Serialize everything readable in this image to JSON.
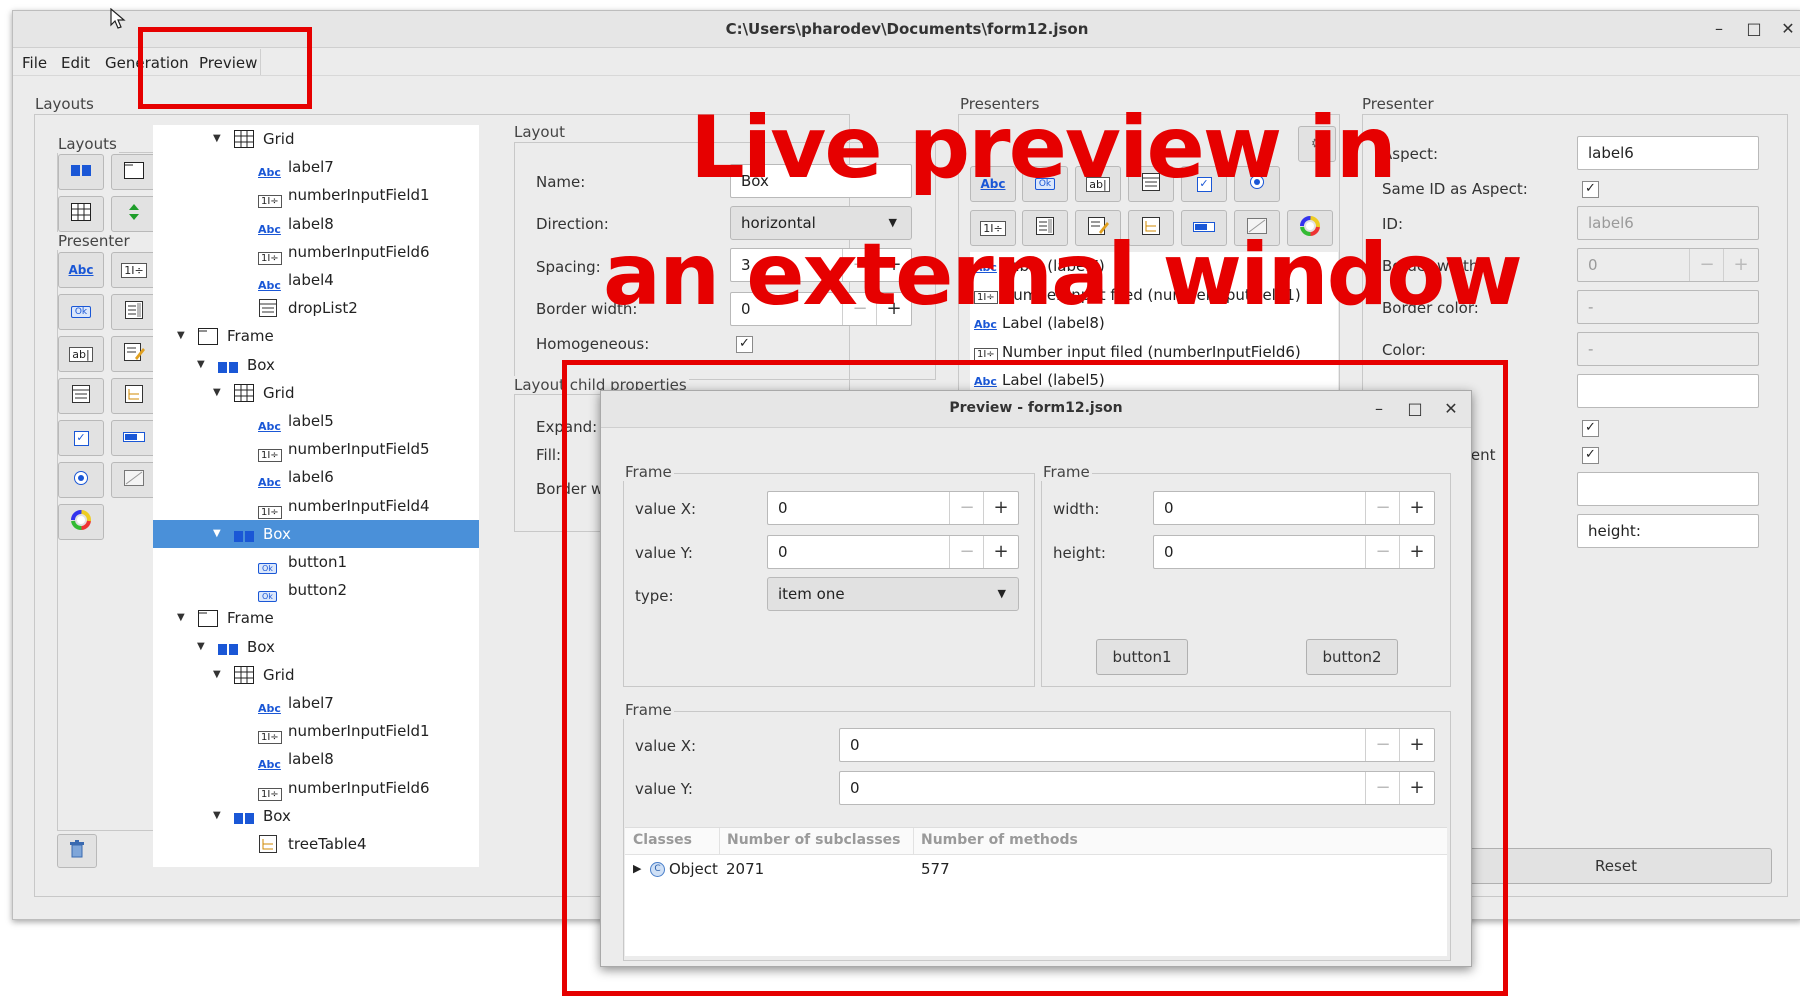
{
  "window": {
    "title": "C:\\Users\\pharodev\\Documents\\form12.json",
    "minimize": "–",
    "maximize": "□",
    "close": "✕"
  },
  "menu": [
    "File",
    "Edit",
    "Generation",
    "Preview"
  ],
  "layouts_panel": {
    "title": "Layouts",
    "layouts_label": "Layouts",
    "presenter_label": "Presenter",
    "tree": [
      {
        "label": "Grid",
        "icon": "grid"
      },
      {
        "label": "label7",
        "icon": "label"
      },
      {
        "label": "numberInputField1",
        "icon": "number"
      },
      {
        "label": "label8",
        "icon": "label"
      },
      {
        "label": "numberInputField6",
        "icon": "number"
      },
      {
        "label": "label4",
        "icon": "label"
      },
      {
        "label": "dropList2",
        "icon": "droplist"
      },
      {
        "label": "Frame",
        "icon": "frame"
      },
      {
        "label": "Box",
        "icon": "box"
      },
      {
        "label": "Grid",
        "icon": "grid"
      },
      {
        "label": "label5",
        "icon": "label"
      },
      {
        "label": "numberInputField5",
        "icon": "number"
      },
      {
        "label": "label6",
        "icon": "label"
      },
      {
        "label": "numberInputField4",
        "icon": "number"
      },
      {
        "label": "Box",
        "icon": "box"
      },
      {
        "label": "button1",
        "icon": "button"
      },
      {
        "label": "button2",
        "icon": "button"
      },
      {
        "label": "Frame",
        "icon": "frame"
      },
      {
        "label": "Box",
        "icon": "box"
      },
      {
        "label": "Grid",
        "icon": "grid"
      },
      {
        "label": "label7",
        "icon": "label"
      },
      {
        "label": "numberInputField1",
        "icon": "number"
      },
      {
        "label": "label8",
        "icon": "label"
      },
      {
        "label": "numberInputField6",
        "icon": "number"
      },
      {
        "label": "Box",
        "icon": "box"
      },
      {
        "label": "treeTable4",
        "icon": "tree"
      }
    ]
  },
  "layout_panel": {
    "title": "Layout",
    "name_label": "Name:",
    "name_value": "Box",
    "direction_label": "Direction:",
    "direction_value": "horizontal",
    "spacing_label": "Spacing:",
    "spacing_value": "3",
    "border_width_label": "Border width:",
    "border_width_value": "0",
    "homogeneous_label": "Homogeneous:",
    "child_props_title": "Layout child properties",
    "expand_label": "Expand:",
    "fill_label": "Fill:",
    "border_label": "Border wi"
  },
  "presenters_panel": {
    "title": "Presenters",
    "list": [
      {
        "text": "Label (label7)",
        "icon": "label"
      },
      {
        "text": "Number input filed (numberInputField1)",
        "icon": "number"
      },
      {
        "text": "Label (label8)",
        "icon": "label"
      },
      {
        "text": "Number input filed (numberInputField6)",
        "icon": "number"
      },
      {
        "text": "Label (label5)",
        "icon": "label"
      }
    ]
  },
  "presenter_panel": {
    "title": "Presenter",
    "aspect_label": "Aspect:",
    "aspect_value": "label6",
    "same_id_label": "Same ID as Aspect:",
    "id_label": "ID:",
    "id_value": "label6",
    "border_width_label": "Border width:",
    "border_width_value": "0",
    "border_color_label": "Border color:",
    "border_color_value": "-",
    "color_label": "Color:",
    "color_value": "-",
    "content_label": "tent",
    "height_value": "height:",
    "reset_label": "Reset"
  },
  "overlay": {
    "line1": "Live preview in",
    "line2": "an external window"
  },
  "preview_window": {
    "title": "Preview - form12.json",
    "frame1": {
      "title": "Frame",
      "value_x_label": "value X:",
      "value_x": "0",
      "value_y_label": "value Y:",
      "value_y": "0",
      "type_label": "type:",
      "type_value": "item one"
    },
    "frame2": {
      "title": "Frame",
      "width_label": "width:",
      "width_value": "0",
      "height_label": "height:",
      "height_value": "0",
      "button1": "button1",
      "button2": "button2"
    },
    "frame3": {
      "title": "Frame",
      "value_x_label": "value X:",
      "value_x": "0",
      "value_y_label": "value Y:",
      "value_y": "0"
    },
    "table": {
      "columns": [
        "Classes",
        "Number of subclasses",
        "Number of methods"
      ],
      "row": {
        "name": "Object",
        "subclasses": "2071",
        "methods": "577"
      }
    }
  },
  "colors": {
    "accent": "#4a90d9",
    "highlight": "#e60000",
    "window_bg": "#ececec"
  }
}
